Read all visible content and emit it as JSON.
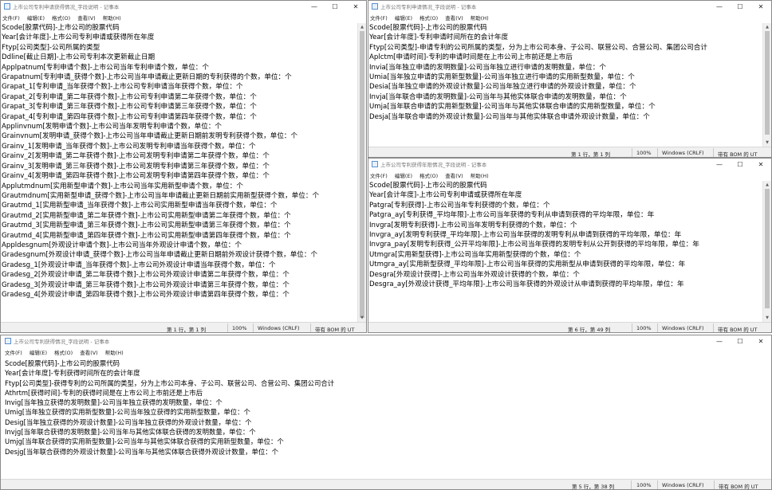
{
  "menu": [
    "文件(F)",
    "编辑(E)",
    "格式(O)",
    "查看(V)",
    "帮助(H)"
  ],
  "controls": {
    "minimize": "—",
    "maximize": "☐",
    "close": "✕"
  },
  "windows": {
    "top_left": {
      "title": "上市公司专利申请获得情况_字段说明 - 记事本",
      "lines": [
        "Scode[股票代码]-上市公司的股票代码",
        "Year[会计年度]-上市公司专利申请或获得所在年度",
        "Ftyp[公司类型]-公司所属的类型",
        "Ddline[截止日期]-上市公司专利本次更新截止日期",
        "Applpatnum[专利申请个数]-上市公司当年专利申请个数，单位：个",
        "Grapatnum[专利申请_获得个数]-上市公司当年申请截止更新日期的专利获得的个数，单位：个",
        "Grapat_1[专利申请_当年获得个数]-上市公司专利申请当年获得个数，单位：个",
        "Grapat_2[专利申请_第二年获得个数]-上市公司专利申请第二年获得个数，单位：个",
        "Grapat_3[专利申请_第三年获得个数]-上市公司专利申请第三年获得个数，单位：个",
        "Grapat_4[专利申请_第四年获得个数]-上市公司专利申请第四年获得个数，单位：个",
        "Applinvnum[发明申请个数]-上市公司当年发明专利申请个数，单位：个",
        "Grainvnum[发明申请_获得个数]-上市公司当年申请截止更新日期前发明专利获得个数，单位：个",
        "Grainv_1[发明申请_当年获得个数]-上市公司发明专利申请当年获得个数，单位：个",
        "Grainv_2[发明申请_第二年获得个数]-上市公司发明专利申请第二年获得个数，单位：个",
        "Grainv_3[发明申请_第三年获得个数]-上市公司发明专利申请第三年获得个数，单位：个",
        "Grainv_4[发明申请_第四年获得个数]-上市公司发明专利申请第四年获得个数，单位：个",
        "Applutmdnum[实用新型申请个数]-上市公司当年实用新型申请个数，单位：个",
        "Grautmdnum[实用新型申请_获得个数]-上市公司当年申请截止更新日期前实用新型获得个数，单位：个",
        "Grautmd_1[实用新型申请_当年获得个数]-上市公司实用新型申请当年获得个数，单位：个",
        "Grautmd_2[实用新型申请_第二年获得个数]-上市公司实用新型申请第二年获得个数，单位：个",
        "Grautmd_3[实用新型申请_第三年获得个数]-上市公司实用新型申请第三年获得个数，单位：个",
        "Grautmd_4[实用新型申请_第四年获得个数]-上市公司实用新型申请第四年获得个数，单位：个",
        "Appldesgnum[外观设计申请个数]-上市公司当年外观设计申请个数，单位：个",
        "Gradesgnum[外观设计申请_获得个数]-上市公司当年申请截止更新日期前外观设计获得个数，单位：个",
        "Gradesg_1[外观设计申请_当年获得个数]-上市公司外观设计申请当年获得个数，单位：个",
        "Gradesg_2[外观设计申请_第二年获得个数]-上市公司外观设计申请第二年获得个数，单位：个",
        "Gradesg_3[外观设计申请_第三年获得个数]-上市公司外观设计申请第三年获得个数，单位：个",
        "Gradesg_4[外观设计申请_第四年获得个数]-上市公司外观设计申请第四年获得个数，单位：个"
      ],
      "status": {
        "position": "第 1 行，第 1 列",
        "zoom": "100%",
        "eol": "Windows (CRLF)",
        "encoding": "带有 BOM 的 UT"
      },
      "scroll_fraction": 0.0
    },
    "top_right": {
      "title": "上市公司专利申请情况_字段说明 - 记事本",
      "lines": [
        "Scode[股票代码]-上市公司的股票代码",
        "Year[会计年度]-专利申请时间所在的会计年度",
        "Ftyp[公司类型]-申请专利的公司所属的类型，分为上市公司本身、子公司、联营公司、合营公司、集团公司合计",
        "Aplctm[申请时间]-专利的申请时间是在上市公司上市前还是上市后",
        "Invia[当年独立申请的发明数量]-公司当年独立进行申请的发明数量，单位：个",
        "Umia[当年独立申请的实用新型数量]-公司当年独立进行申请的实用新型数量，单位：个",
        "Desia[当年独立申请的外观设计数量]-公司当年独立进行申请的外观设计数量，单位：个",
        "Invja[当年联合申请的发明数量]-公司当年与其他实体联合申请的发明数量，单位：个",
        "Umja[当年联合申请的实用新型数量]-公司当年与其他实体联合申请的实用新型数量，单位：个",
        "Desja[当年联合申请的外观设计数量]-公司当年与其他实体联合申请外观设计数量，单位：个"
      ],
      "status": {
        "position": "第 1 行，第 1 列",
        "zoom": "100%",
        "eol": "Windows (CRLF)",
        "encoding": "带有 BOM 的 UT"
      },
      "scroll_fraction": 0.0
    },
    "mid_right": {
      "title": "上市公司专利获得年限情况_字段说明 - 记事本",
      "lines": [
        "Scode[股票代码]-上市公司的股票代码",
        "Year[会计年度]-上市公司专利申请或获得所在年度",
        "Patgra[专利获得]-上市公司当年专利获得的个数，单位：个",
        "Patgra_ay[专利获得_平均年限]-上市公司当年获得的专利从申请到获得的平均年限，单位：年",
        "Invgra[发明专利获得]-上市公司当年发明专利获得的个数，单位：个",
        "Invgra_ay[发明专利获得_平均年限]-上市公司当年获得的发明专利从申请到获得的平均年限，单位：年",
        "Invgra_pay[发明专利获得_公开平均年限]-上市公司当年获得的发明专利从公开到获得的平均年限，单位：年",
        "Utmgra[实用新型获得]-上市公司当年实用新型获得的个数，单位：个",
        "Utmgra_ay[实用新型获得_平均年限]-上市公司当年获得的实用新型从申请到获得的平均年限，单位：年",
        "Desgra[外观设计获得]-上市公司当年外观设计获得的个数，单位：个",
        "Desgra_ay[外观设计获得_平均年限]-上市公司当年获得的外观设计从申请到获得的平均年限，单位：年"
      ],
      "status": {
        "position": "第 6 行，第 49 列",
        "zoom": "100%",
        "eol": "Windows (CRLF)",
        "encoding": "带有 BOM 的 UT"
      },
      "scroll_fraction": 0.0
    },
    "bottom": {
      "title": "上市公司专利获得情况_字段说明 - 记事本",
      "lines": [
        "Scode[股票代码]-上市公司的股票代码",
        "Year[会计年度]-专利获得时间所在的会计年度",
        "Ftyp[公司类型]-获得专利的公司所属的类型，分为上市公司本身、子公司、联营公司、合营公司、集团公司合计",
        "Athrtm[获得时间]-专利的获得时间是在上市公司上市前还是上市后",
        "Invig[当年独立获得的发明数量]-公司当年独立获得的发明数量，单位：个",
        "Umig[当年独立获得的实用新型数量]-公司当年独立获得的实用新型数量，单位：个",
        "Desig[当年独立获得的外观设计数量]-公司当年独立获得的外观设计数量，单位：个",
        "Invjg[当年联合获得的发明数量]-公司当年与其他实体联合获得的发明数量，单位：个",
        "Umjg[当年联合获得的实用新型数量]-公司当年与其他实体联合获得的实用新型数量，单位：个",
        "Desjg[当年联合获得的外观设计数量]-公司当年与其他实体联合获得外观设计数量，单位：个"
      ],
      "status": {
        "position": "第 5 行，第 38 列",
        "zoom": "100%",
        "eol": "Windows (CRLF)",
        "encoding": "带有 BOM 的 UT"
      },
      "scroll_fraction": 0.0
    }
  },
  "colors": {
    "window_border": "#8a8a8a",
    "statusbar_bg": "#f0f0f0",
    "title_text": "#777777",
    "accent": "#5a8fd0"
  }
}
